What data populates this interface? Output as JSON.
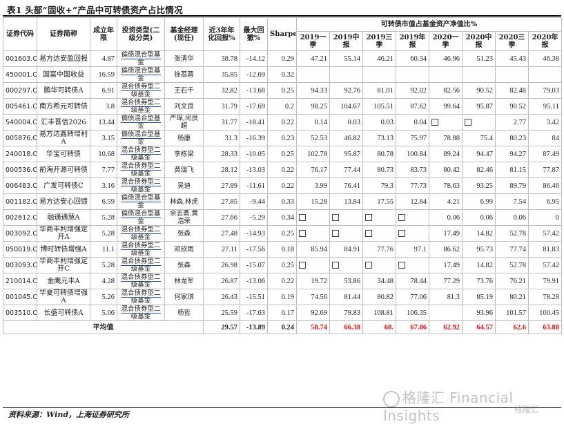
{
  "title": "表1 头部“固收+”产品中可转债资产占比情况",
  "headers": {
    "code": "证券代码",
    "name": "证券简称",
    "founded": "成立年限",
    "type": "投资类型(二级分类)",
    "manager": "基金经理(现任)",
    "ret3y": "近3年年化回报%",
    "mdd": "最大回撤%",
    "sharpe": "Sharpe",
    "group": "可转债市值占基金资产净值比%",
    "periods": [
      "2019一季",
      "2019中报",
      "2019三季",
      "2019年报",
      "2020一季",
      "2020中报",
      "2020三季",
      "2020年报"
    ]
  },
  "rows": [
    {
      "code": "001603.OF",
      "name": "易方达安盈回报",
      "founded": "4.87",
      "type": "偏债混合型基金",
      "manager": "张清华",
      "ret3y": "38.78",
      "mdd": "-14.12",
      "sharpe": "0.29",
      "v": [
        "47.21",
        "55.14",
        "46.21",
        "60.34",
        "46.96",
        "51.23",
        "45.43",
        "46.38"
      ]
    },
    {
      "code": "450001.OF",
      "name": "国富中国收益",
      "founded": "16.59",
      "type": "偏债混合型基金",
      "manager": "徐荔蓉",
      "ret3y": "35.85",
      "mdd": "-12.69",
      "sharpe": "0.32",
      "v": [
        "",
        "",
        "",
        "",
        "",
        "",
        "",
        ""
      ]
    },
    {
      "code": "000297.OF",
      "name": "鹏华可转债A",
      "founded": "6.91",
      "type": "混合债券型二级基金",
      "manager": "王石千",
      "ret3y": "32.82",
      "mdd": "-13.68",
      "sharpe": "0.25",
      "v": [
        "94.33",
        "92.76",
        "81.01",
        "92.02",
        "82.56",
        "90.52",
        "82.48",
        "79.03"
      ]
    },
    {
      "code": "005461.OF",
      "name": "南方希元可转债",
      "founded": "3.8",
      "type": "混合债券型二级基金",
      "manager": "刘文良",
      "ret3y": "31.79",
      "mdd": "-17.69",
      "sharpe": "0.2",
      "v": [
        "98.25",
        "104.67",
        "105.51",
        "87.62",
        "99.64",
        "95.87",
        "90.52",
        "95.11"
      ]
    },
    {
      "code": "540004.OF",
      "name": "汇丰晋信2026",
      "founded": "13.44",
      "type": "偏债混合型基金",
      "manager": "严琛,闵良超",
      "ret3y": "31.77",
      "mdd": "-18.41",
      "sharpe": "0.22",
      "v": [
        "0.14",
        "0.03",
        "0.03",
        "0.04",
        "□",
        "□",
        "2.77",
        "3.42"
      ]
    },
    {
      "code": "005876.OF",
      "name": "易方达鑫转增利A",
      "founded": "3.15",
      "type": "偏债混合型基金",
      "manager": "杨康",
      "ret3y": "31.3",
      "mdd": "-16.39",
      "sharpe": "0.23",
      "v": [
        "52.53",
        "46.82",
        "73.13",
        "75.97",
        "78.88",
        "75.4",
        "80.23",
        "84"
      ]
    },
    {
      "code": "240018.OF",
      "name": "华宝可转债",
      "founded": "10.68",
      "type": "混合债券型二级基金",
      "manager": "李栋梁",
      "ret3y": "28.33",
      "mdd": "-10.05",
      "sharpe": "0.25",
      "v": [
        "102.78",
        "95.87",
        "80.78",
        "100.84",
        "89.24",
        "94.47",
        "94.27",
        "87.49"
      ]
    },
    {
      "code": "000536.OF",
      "name": "前海开源可转债",
      "founded": "7.77",
      "type": "混合债券型二级基金",
      "manager": "黄瑞飞",
      "ret3y": "28.12",
      "mdd": "-13.03",
      "sharpe": "0.22",
      "v": [
        "76.17",
        "77.44",
        "80.73",
        "83.73",
        "80.42",
        "82.46",
        "81.15",
        "77.87"
      ]
    },
    {
      "code": "006483.OF",
      "name": "广发可转债C",
      "founded": "3.16",
      "type": "混合债券型二级基金",
      "manager": "吴迪",
      "ret3y": "27.89",
      "mdd": "-11.61",
      "sharpe": "0.22",
      "v": [
        "3.99",
        "76.41",
        "79.3",
        "77.73",
        "78.63",
        "93.25",
        "89.79",
        "86.46"
      ]
    },
    {
      "code": "001182.OF",
      "name": "易方达安心回馈",
      "founded": "6.59",
      "type": "偏债混合型基金",
      "manager": "林森,林虎",
      "ret3y": "27.85",
      "mdd": "-9.44",
      "sharpe": "0.33",
      "v": [
        "15.28",
        "13.84",
        "17.55",
        "12.84",
        "4.21",
        "6.99",
        "7.54",
        "6.95"
      ]
    },
    {
      "code": "002612.OF",
      "name": "融通通慧A",
      "founded": "5.28",
      "type": "偏债混合型基金",
      "manager": "余志勇,黄浩荣",
      "ret3y": "27.66",
      "mdd": "-5.29",
      "sharpe": "0.34",
      "v": [
        "□",
        "□",
        "□",
        "□",
        "0.06",
        "0.06",
        "0.06",
        "0"
      ]
    },
    {
      "code": "003092.OF",
      "name": "华商丰利增强定开A",
      "founded": "5.28",
      "type": "混合债券型二级基金",
      "manager": "张森",
      "ret3y": "27.48",
      "mdd": "-14.93",
      "sharpe": "0.25",
      "v": [
        "□",
        "□",
        "□",
        "□",
        "17.49",
        "14.82",
        "52.78",
        "57.42"
      ]
    },
    {
      "code": "050019.OF",
      "name": "博时转债增强A",
      "founded": "11.1",
      "type": "混合债券型二级基金",
      "manager": "邓欣雨",
      "ret3y": "27.11",
      "mdd": "-17.56",
      "sharpe": "0.18",
      "v": [
        "85.94",
        "84.91",
        "77.76",
        "97.1",
        "86.62",
        "95.73",
        "77.74",
        "81.83"
      ]
    },
    {
      "code": "003093.OF",
      "name": "华商丰利增强定开C",
      "founded": "5.28",
      "type": "混合债券型二级基金",
      "manager": "张森",
      "ret3y": "26.98",
      "mdd": "-15.07",
      "sharpe": "0.25",
      "v": [
        "□",
        "□",
        "□",
        "□",
        "17.49",
        "14.82",
        "52.78",
        "57.42"
      ]
    },
    {
      "code": "210014.OF",
      "name": "金鹰元丰A",
      "founded": "4.28",
      "type": "混合债券型二级基金",
      "manager": "林龙军",
      "ret3y": "26.87",
      "mdd": "-13.06",
      "sharpe": "0.22",
      "v": [
        "19.72",
        "53.86",
        "34.48",
        "78.44",
        "77.29",
        "73.76",
        "76.21",
        "79.91"
      ]
    },
    {
      "code": "001045.OF",
      "name": "华夏可转债增强A",
      "founded": "5.26",
      "type": "混合债券型二级基金",
      "manager": "何家琪",
      "ret3y": "26.43",
      "mdd": "-15.51",
      "sharpe": "0.19",
      "v": [
        "74.56",
        "81.44",
        "80.82",
        "77.06",
        "81.3",
        "85.19",
        "80.21",
        "78.28"
      ]
    },
    {
      "code": "003510.OF",
      "name": "长盛可转债A",
      "founded": "5.06",
      "type": "混合债券型二级基金",
      "manager": "杨哲",
      "ret3y": "25.59",
      "mdd": "-17.63",
      "sharpe": "0.17",
      "v": [
        "92.69",
        "79.83",
        "108.81",
        "106.35",
        "",
        "93.96",
        "101.57",
        "100.45"
      ]
    }
  ],
  "average": {
    "label": "平均值",
    "ret3y": "29.57",
    "mdd": "-13.89",
    "sharpe": "0.24",
    "v": [
      "58.74",
      "66.38",
      "68.",
      "67.86",
      "62.92",
      "64.57",
      "62.6",
      "63.88"
    ]
  },
  "source": "资料来源：Wind，上海证券研究所",
  "watermark": "格隆汇 Financial Insights",
  "watermark2": "格隆汇"
}
